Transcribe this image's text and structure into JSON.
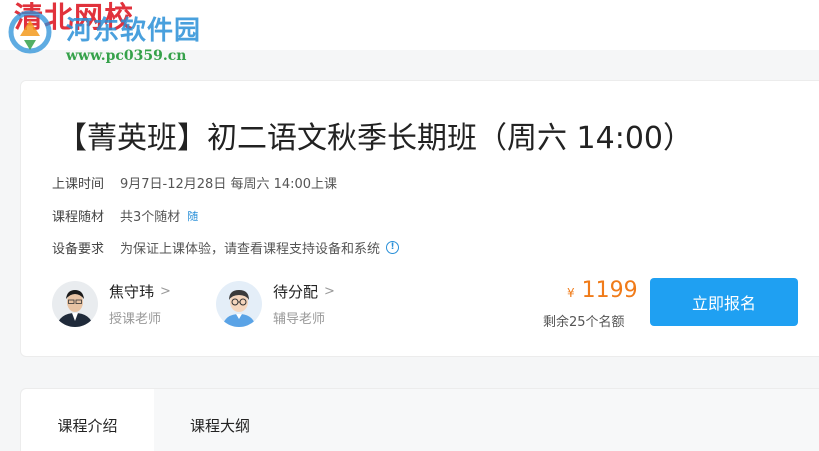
{
  "header": {
    "brand": "清北网校",
    "watermark_title": "河东软件园",
    "watermark_url": "www.pc0359.cn"
  },
  "course": {
    "title": "【菁英班】初二语文秋季长期班（周六 14:00）",
    "schedule_label": "上课时间",
    "schedule_value": "9月7日-12月28日 每周六 14:00上课",
    "materials_label": "课程随材",
    "materials_value": "共3个随材",
    "materials_tag": "随",
    "device_label": "设备要求",
    "device_value": "为保证上课体验，请查看课程支持设备和系统",
    "device_icon": "info-icon"
  },
  "teachers": [
    {
      "name": "焦守玮",
      "role": "授课老师"
    },
    {
      "name": "待分配",
      "role": "辅导老师"
    }
  ],
  "pricing": {
    "currency": "¥",
    "price": "1199",
    "remaining": "剩余25个名额",
    "price_color": "#f07b19"
  },
  "actions": {
    "enroll_label": "立即报名",
    "accent": "#1fa0f2"
  },
  "tabs": [
    {
      "label": "课程介绍",
      "active": true
    },
    {
      "label": "课程大纲",
      "active": false
    }
  ]
}
